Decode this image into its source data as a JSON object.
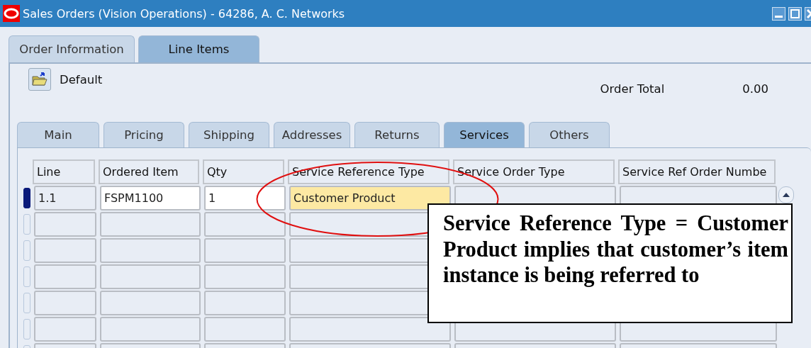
{
  "window": {
    "title": "Sales Orders (Vision Operations) - 64286, A. C. Networks"
  },
  "tabs": [
    {
      "label": "Order Information",
      "selected": false
    },
    {
      "label": "Line Items",
      "selected": true
    }
  ],
  "toolbar": {
    "default_label": "Default"
  },
  "order_total": {
    "label": "Order Total",
    "value": "0.00"
  },
  "line_tabs": [
    {
      "label": "Main",
      "selected": false
    },
    {
      "label": "Pricing",
      "selected": false
    },
    {
      "label": "Shipping",
      "selected": false
    },
    {
      "label": "Addresses",
      "selected": false
    },
    {
      "label": "Returns",
      "selected": false
    },
    {
      "label": "Services",
      "selected": true
    },
    {
      "label": "Others",
      "selected": false
    }
  ],
  "table": {
    "columns": [
      {
        "label": "Line",
        "kind": "readonly"
      },
      {
        "label": "Ordered Item",
        "kind": "editable"
      },
      {
        "label": "Qty",
        "kind": "editable"
      },
      {
        "label": "Service Reference Type",
        "kind": "focused"
      },
      {
        "label": "Service Order Type",
        "kind": "readonly"
      },
      {
        "label": "Service Ref Order Numbe",
        "kind": "readonly"
      }
    ],
    "rows": [
      {
        "selected": true,
        "cells": [
          "1.1",
          "FSPM1100",
          "1",
          "Customer Product"
        ]
      }
    ]
  },
  "callout": {
    "text": "Service Reference Type = Customer Product implies that customer’s item instance is being referred to"
  }
}
